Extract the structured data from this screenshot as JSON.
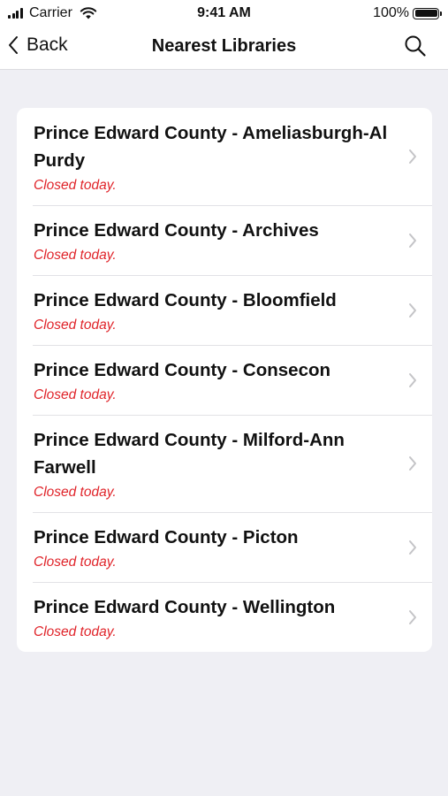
{
  "status_bar": {
    "carrier": "Carrier",
    "time": "9:41 AM",
    "battery": "100%"
  },
  "nav": {
    "back_label": "Back",
    "title": "Nearest Libraries",
    "search_icon": "search-icon"
  },
  "libraries": [
    {
      "name": "Prince Edward County - Ameliasburgh-Al Purdy",
      "status": "Closed today."
    },
    {
      "name": "Prince Edward County - Archives",
      "status": "Closed today."
    },
    {
      "name": "Prince Edward County - Bloomfield",
      "status": "Closed today."
    },
    {
      "name": "Prince Edward County - Consecon",
      "status": "Closed today."
    },
    {
      "name": "Prince Edward County - Milford-Ann Farwell",
      "status": "Closed today."
    },
    {
      "name": "Prince Edward County - Picton",
      "status": "Closed today."
    },
    {
      "name": "Prince Edward County - Wellington",
      "status": "Closed today."
    }
  ],
  "colors": {
    "status_closed": "#e0242a",
    "background": "#efeff4"
  }
}
